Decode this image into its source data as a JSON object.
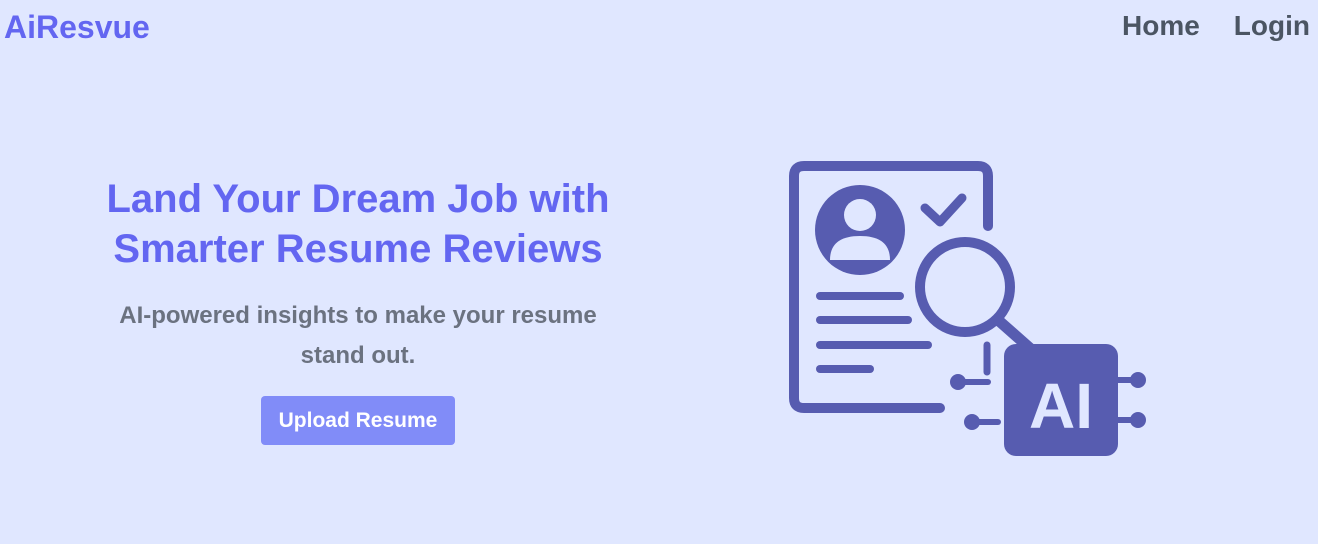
{
  "nav": {
    "brand": "AiResvue",
    "links": [
      {
        "label": "Home"
      },
      {
        "label": "Login"
      }
    ]
  },
  "hero": {
    "title_line1": "Land Your Dream Job with",
    "title_line2": "Smarter Resume Reviews",
    "subtitle": "AI-powered insights to make your resume stand out.",
    "cta_label": "Upload Resume",
    "illustration": {
      "icon": "resume-ai-review-icon",
      "chip_text": "AI"
    }
  },
  "colors": {
    "background": "#e0e7ff",
    "brand": "#6366f1",
    "nav_text": "#4b5563",
    "subtitle": "#6b7280",
    "button": "#818cf8",
    "illustration": "#575cb0"
  }
}
